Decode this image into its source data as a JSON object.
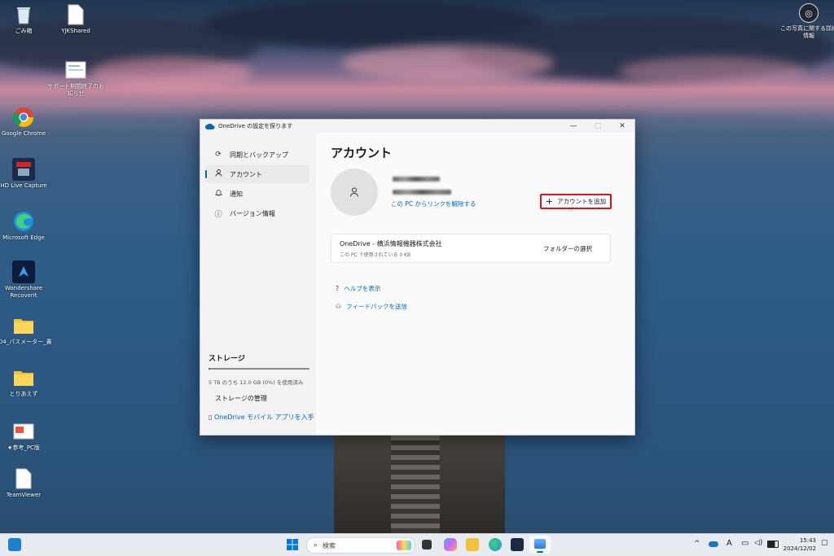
{
  "desktop": {
    "icons": [
      {
        "label": "ごみ箱",
        "icon": "recycle-bin-icon"
      },
      {
        "label": "YJKShared",
        "icon": "document-icon"
      },
      {
        "label": "サポート期間終了のお知らせ",
        "icon": "document-icon"
      },
      {
        "label": "Google Chrome",
        "icon": "chrome-icon"
      },
      {
        "label": "HD Live Capture",
        "icon": "capture-app-icon"
      },
      {
        "label": "Microsoft Edge",
        "icon": "edge-icon"
      },
      {
        "label": "Wondershare Recoverit",
        "icon": "recoverit-icon"
      },
      {
        "label": "004_パスメーター_書",
        "icon": "folder-icon"
      },
      {
        "label": "とりあえず",
        "icon": "folder-icon"
      },
      {
        "label": "★参考_PC版",
        "icon": "slide-file-icon"
      },
      {
        "label": "TeamViewer",
        "icon": "document-icon"
      }
    ],
    "photo_info": "この写真に関する詳細情報"
  },
  "window": {
    "title": "OneDrive の設定を探ります",
    "controls": {
      "minimize": "—",
      "maximize": "□",
      "close": "✕"
    },
    "nav": [
      {
        "label": "同期とバックアップ",
        "icon": "sync-icon"
      },
      {
        "label": "アカウント",
        "icon": "person-icon"
      },
      {
        "label": "通知",
        "icon": "bell-icon"
      },
      {
        "label": "バージョン情報",
        "icon": "info-icon"
      }
    ],
    "storage": {
      "title": "ストレージ",
      "usage": "5 TB のうち 12.0 GB (0%) を使用済み",
      "usage_fraction": 0.0,
      "manage": "ストレージの管理",
      "mobile": "OneDrive モバイル アプリを入手"
    },
    "account": {
      "heading": "アカウント",
      "unlink": "この PC からリンクを解除する",
      "add_account": "アカウントを追加",
      "org_name": "OneDrive - 横浜情報機器株式会社",
      "org_usage": "この PC で使用されている 0 KB",
      "choose_folders": "フォルダーの選択",
      "help": "ヘルプを表示",
      "feedback": "フィードバックを送信"
    }
  },
  "taskbar": {
    "search_placeholder": "検索",
    "time": "15:43",
    "date": "2024/12/02",
    "ime": "A"
  },
  "colors": {
    "accent": "#0067c0",
    "highlight_box": "#d9161e"
  }
}
